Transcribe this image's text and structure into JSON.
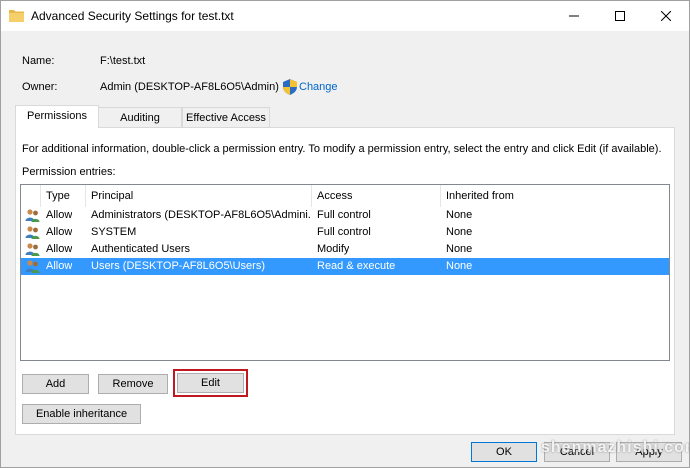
{
  "window": {
    "title": "Advanced Security Settings for test.txt"
  },
  "info": {
    "name_label": "Name:",
    "name_value": "F:\\test.txt",
    "owner_label": "Owner:",
    "owner_value": "Admin (DESKTOP-AF8L6O5\\Admin)",
    "change_link": "Change"
  },
  "tabs": [
    {
      "label": "Permissions",
      "active": true
    },
    {
      "label": "Auditing",
      "active": false
    },
    {
      "label": "Effective Access",
      "active": false
    }
  ],
  "instructions": "For additional information, double-click a permission entry. To modify a permission entry, select the entry and click Edit (if available).",
  "entries_label": "Permission entries:",
  "table": {
    "headers": {
      "type": "Type",
      "principal": "Principal",
      "access": "Access",
      "inherited": "Inherited from"
    },
    "rows": [
      {
        "type": "Allow",
        "principal": "Administrators (DESKTOP-AF8L6O5\\Admini...",
        "access": "Full control",
        "inherited": "None",
        "selected": false
      },
      {
        "type": "Allow",
        "principal": "SYSTEM",
        "access": "Full control",
        "inherited": "None",
        "selected": false
      },
      {
        "type": "Allow",
        "principal": "Authenticated Users",
        "access": "Modify",
        "inherited": "None",
        "selected": false
      },
      {
        "type": "Allow",
        "principal": "Users (DESKTOP-AF8L6O5\\Users)",
        "access": "Read & execute",
        "inherited": "None",
        "selected": true
      }
    ]
  },
  "buttons": {
    "add": "Add",
    "remove": "Remove",
    "edit": "Edit",
    "enable_inheritance": "Enable inheritance",
    "ok": "OK",
    "cancel": "Cancel",
    "apply": "Apply"
  },
  "watermark": "shenmazhishi.com",
  "colors": {
    "selection": "#3399ff",
    "link": "#0066cc",
    "focus_outline": "#c0181e",
    "default_border": "#0078d7"
  }
}
